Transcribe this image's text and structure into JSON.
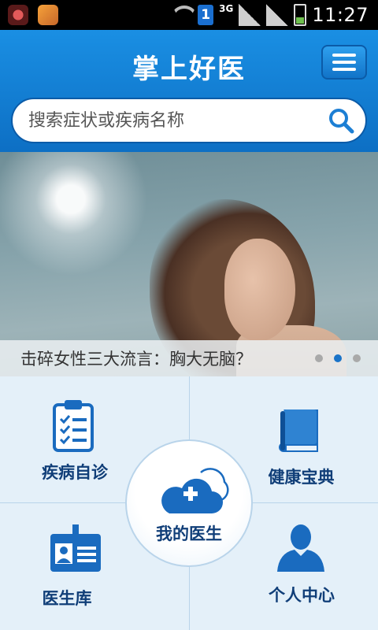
{
  "status_bar": {
    "time": "11:27",
    "sim_number": "1",
    "network": "3G",
    "icons": [
      "notification-app-icon",
      "notification-app-icon",
      "wifi-icon",
      "sim-icon",
      "signal-icon",
      "signal-icon",
      "battery-icon"
    ]
  },
  "header": {
    "title": "掌上好医",
    "menu_icon": "menu-icon"
  },
  "search": {
    "placeholder": "搜索症状或疾病名称",
    "icon": "search-icon"
  },
  "banner": {
    "caption": "击碎女性三大流言：胸大无脑？",
    "slide_count": 3,
    "active_slide": 2
  },
  "features": {
    "self_diagnosis": {
      "label": "疾病自诊",
      "icon": "clipboard-checklist-icon"
    },
    "health_book": {
      "label": "健康宝典",
      "icon": "book-icon"
    },
    "my_doctor": {
      "label": "我的医生",
      "icon": "cloud-plus-icon"
    },
    "doctor_library": {
      "label": "医生库",
      "icon": "id-badge-icon"
    },
    "personal_center": {
      "label": "个人中心",
      "icon": "person-icon"
    }
  },
  "colors": {
    "header_blue": "#1a8fe3",
    "label_navy": "#103e78",
    "icon_blue": "#1a6bbf",
    "grid_bg": "#e4f0f9"
  }
}
